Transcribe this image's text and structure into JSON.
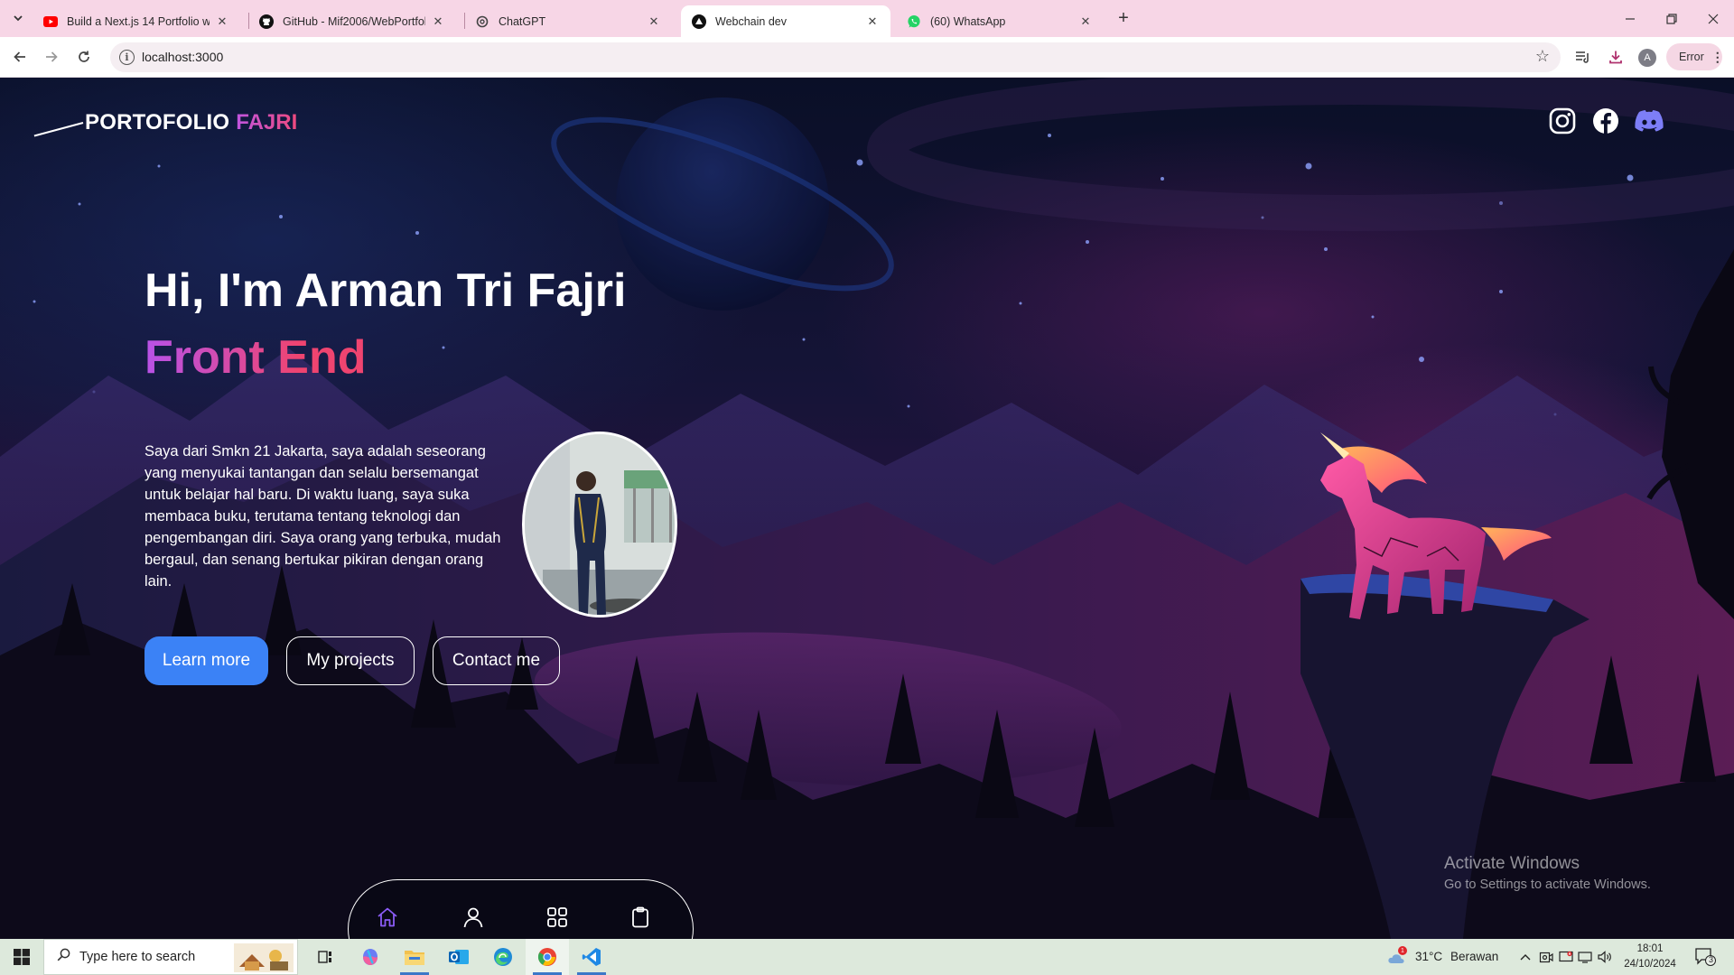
{
  "browser": {
    "tabs": [
      {
        "title": "Build a Next.js 14 Portfolio web",
        "icon": "youtube-icon",
        "color": "#ff0000"
      },
      {
        "title": "GitHub - Mif2006/WebPortfolio",
        "icon": "github-icon",
        "color": "#111111"
      },
      {
        "title": "ChatGPT",
        "icon": "chatgpt-icon",
        "color": "#333333"
      },
      {
        "title": "Webchain dev",
        "icon": "vercel-icon",
        "color": "#111111",
        "active": true
      },
      {
        "title": "(60) WhatsApp",
        "icon": "whatsapp-icon",
        "color": "#25d366"
      }
    ],
    "new_tab": "+",
    "url": "localhost:3000",
    "profile_initial": "A",
    "error_label": "Error"
  },
  "page": {
    "logo": {
      "main": "PORTOFOLIO",
      "accent": "FAJRI"
    },
    "social_icons": [
      "instagram-icon",
      "facebook-icon",
      "discord-icon"
    ],
    "hero": {
      "greeting": "Hi, I'm Arman Tri Fajri",
      "role": "Front End",
      "bio": "Saya dari Smkn 21 Jakarta, saya adalah seseorang yang menyukai tantangan dan selalu bersemangat untuk belajar hal baru. Di waktu luang, saya suka membaca buku, terutama tentang teknologi dan pengembangan diri. Saya orang yang terbuka, mudah bergaul, dan senang bertukar pikiran dengan orang lain."
    },
    "buttons": {
      "learn_more": "Learn more",
      "my_projects": "My projects",
      "contact_me": "Contact me"
    },
    "dock": [
      "home-icon",
      "user-icon",
      "grid-icon",
      "clipboard-icon"
    ],
    "colors": {
      "accent_blue": "#3b82f6",
      "gradient_start": "#b852e8",
      "gradient_end": "#ef4470"
    }
  },
  "watermark": {
    "title": "Activate Windows",
    "subtitle": "Go to Settings to activate Windows."
  },
  "taskbar": {
    "search_placeholder": "Type here to search",
    "weather": {
      "temp": "31°C",
      "condition": "Berawan",
      "badge": "1"
    },
    "time": "18:01",
    "date": "24/10/2024",
    "notifications": "3"
  }
}
